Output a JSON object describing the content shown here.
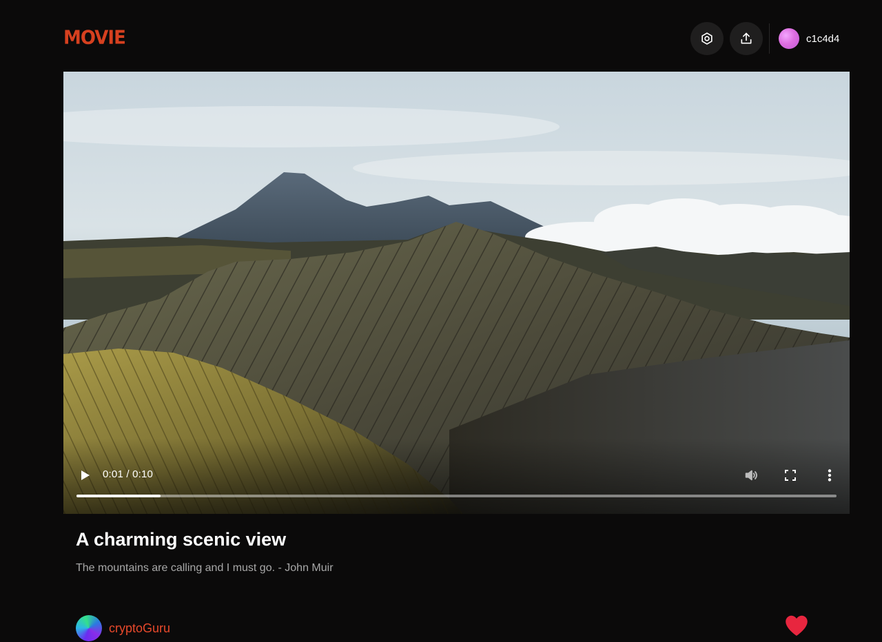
{
  "header": {
    "logo_text": "MOVIE",
    "user": {
      "name": "c1c4d4"
    }
  },
  "player": {
    "time_display": "0:01 / 0:10",
    "progress": 0.111
  },
  "video": {
    "title": "A charming scenic view",
    "description": "The mountains are calling and I must go. - John Muir"
  },
  "author": {
    "name": "cryptoGuru"
  },
  "colors": {
    "brand": "#d6401f",
    "author_link": "#e8492b",
    "like": "#e8263f",
    "background": "#0b0a0a"
  },
  "icons": [
    "settings-icon",
    "upload-icon",
    "play-icon",
    "volume-icon",
    "fullscreen-icon",
    "more-vert-icon",
    "heart-icon"
  ]
}
